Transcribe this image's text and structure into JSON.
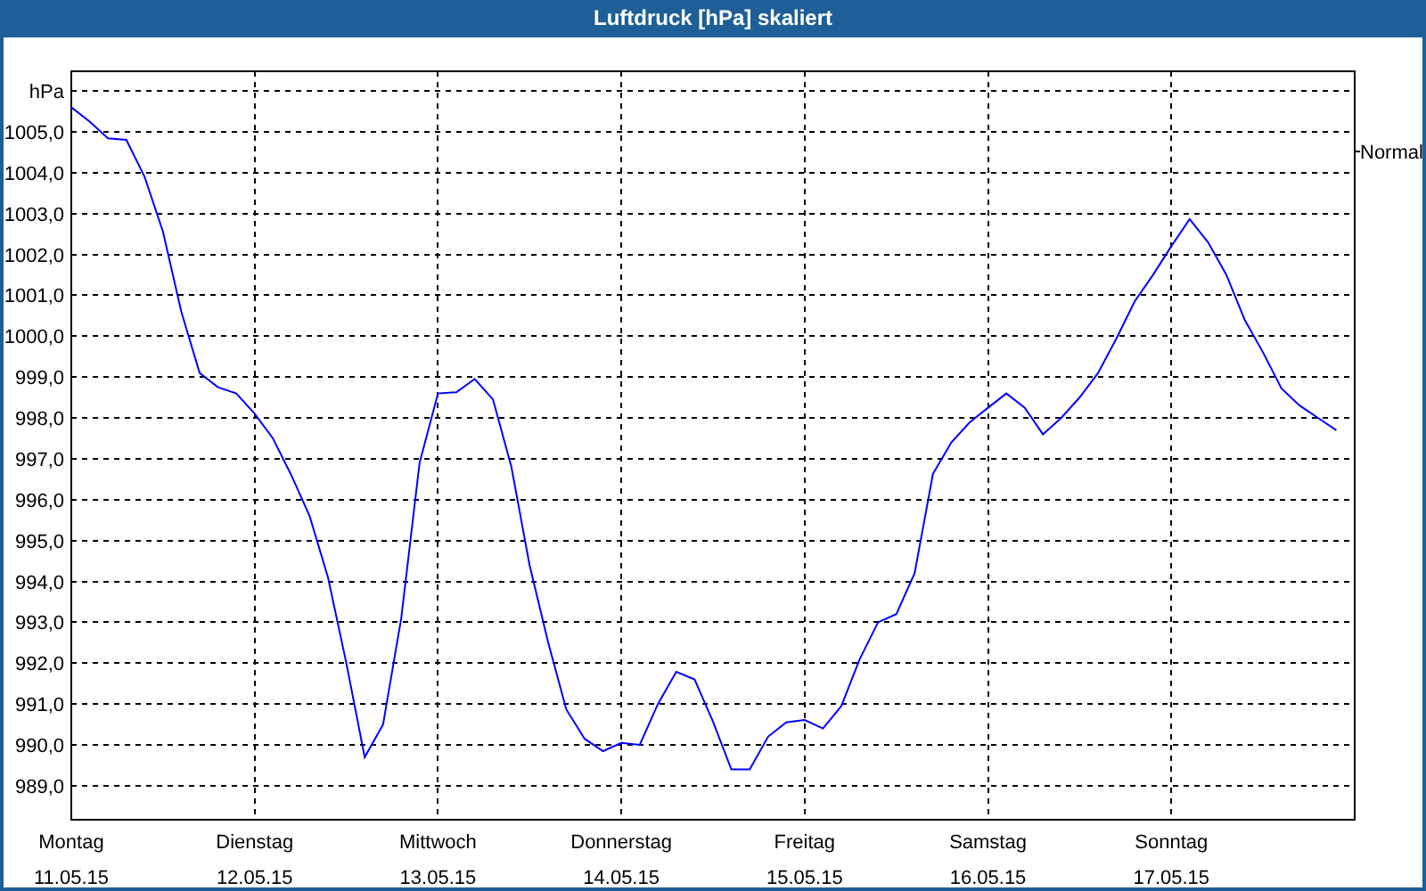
{
  "chart": {
    "chart_data": {
      "type": "line",
      "title": "Luftdruck [hPa] skaliert",
      "ylabel": "hPa",
      "grid": true,
      "ylim": [
        988.17,
        1006.48
      ],
      "categories": [
        "Montag\n11.05.15",
        null,
        null,
        null,
        null,
        null,
        null,
        null,
        null,
        null,
        "Dienstag\n12.05.15",
        null,
        null,
        null,
        null,
        null,
        null,
        null,
        null,
        null,
        "Mittwoch\n13.05.15",
        null,
        null,
        null,
        null,
        null,
        null,
        null,
        null,
        null,
        "Donnerstag\n14.05.15",
        null,
        null,
        null,
        null,
        null,
        null,
        null,
        null,
        null,
        "Freitag\n15.05.15",
        null,
        null,
        null,
        null,
        null,
        null,
        null,
        null,
        null,
        "Samstag\n16.05.15",
        null,
        null,
        null,
        null,
        null,
        null,
        null,
        null,
        null,
        "Sonntag\n17.05.15",
        null,
        null,
        null,
        null,
        null,
        null,
        null,
        null,
        null
      ],
      "yticks": [
        {
          "value": 989,
          "label": "989,0"
        },
        {
          "value": 990,
          "label": "990,0"
        },
        {
          "value": 991,
          "label": "991,0"
        },
        {
          "value": 992,
          "label": "992,0"
        },
        {
          "value": 993,
          "label": "993,0"
        },
        {
          "value": 994,
          "label": "994,0"
        },
        {
          "value": 995,
          "label": "995,0"
        },
        {
          "value": 996,
          "label": "996,0"
        },
        {
          "value": 997,
          "label": "997,0"
        },
        {
          "value": 998,
          "label": "998,0"
        },
        {
          "value": 999,
          "label": "999,0"
        },
        {
          "value": 1000,
          "label": "1000,0"
        },
        {
          "value": 1001,
          "label": "1001,0"
        },
        {
          "value": 1002,
          "label": "1002,0"
        },
        {
          "value": 1003,
          "label": "1003,0"
        },
        {
          "value": 1004,
          "label": "1004,0"
        },
        {
          "value": 1005,
          "label": "1005,0"
        }
      ],
      "annotations": [
        "Normal"
      ],
      "series": [
        {
          "color": "#0000ff",
          "values": [
            1005.6,
            1005.25,
            1004.84,
            1004.8,
            1003.9,
            1002.56,
            1000.6,
            999.1,
            998.75,
            998.6,
            998.1,
            997.5,
            996.6,
            995.6,
            994.1,
            992.0,
            989.7,
            990.5,
            993.1,
            996.9,
            998.6,
            998.63,
            998.95,
            998.45,
            996.8,
            994.4,
            992.53,
            990.87,
            990.15,
            989.85,
            990.05,
            990.0,
            991.0,
            991.79,
            991.6,
            990.57,
            989.4,
            989.4,
            990.2,
            990.55,
            990.61,
            990.4,
            990.95,
            992.1,
            993.0,
            993.2,
            994.2,
            996.63,
            997.4,
            997.89,
            998.25,
            998.6,
            998.25,
            997.6,
            998.0,
            998.5,
            999.1,
            999.94,
            1000.85,
            1001.5,
            1002.2,
            1002.86,
            1002.3,
            1001.5,
            1000.4,
            999.6,
            998.72,
            998.3,
            998.0,
            997.7
          ]
        }
      ]
    }
  }
}
